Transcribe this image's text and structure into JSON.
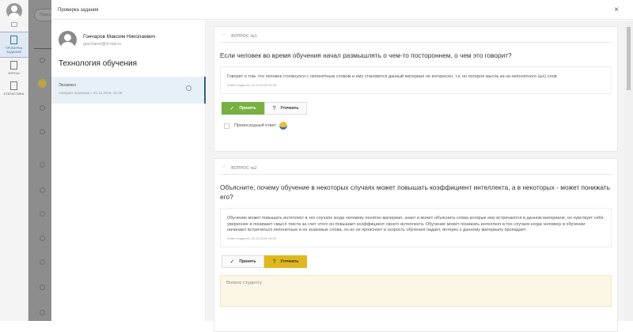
{
  "nav": {
    "items": [
      {
        "label": "Проверка заданий",
        "active": true
      },
      {
        "label": "Курсы"
      },
      {
        "label": "Статистика"
      }
    ]
  },
  "background": {
    "search_placeholder": "Поиск"
  },
  "modal": {
    "title": "Проверка задания",
    "close": "×"
  },
  "student": {
    "name": "Гончаров Максим Николаевич",
    "email": "goncharov@rk-nsk.ru"
  },
  "course": "Технология обучения",
  "task": {
    "name": "Экзамен",
    "status": "Ожидает проверки с 02.12.2018, 16:39"
  },
  "questions": [
    {
      "header": "ВОПРОС №1",
      "text": "Если человек во время обучения начал размышлять о чем-то постороннем, о чем это говорит?",
      "answer": "Говорит о том, что человек столкнулся с непонятным словом и ему становится данный материал не интересен, т.к. он потерял мысль из-за непонятного (ых) слов",
      "meta": "Ответ студента, 02.12.2018 16:39",
      "accept": "Принять",
      "clarify": "Уточнить",
      "excellent": "Превосходный ответ"
    },
    {
      "header": "ВОПРОС №2",
      "text": "Объясните, почему обучение в некоторых случаях может повышать коэффициент интеллекта, а в некоторых - может понижать его?",
      "answer": "Обучение может повышать интеллект в тех случаях когда человеку понятен материал, знает и может объяснить слова которые ему встречаются в данном материале, он чувствует себя увереннее и понимает смысл текста за счет этого он повышает коэффициент своего интеллекта. Обучение может понижать интеллект в тех случаях когда человеку в обучении начинают встречаться непонятные и не знакомые слова, он их не проясняет и скорость обучения падает, интерес к данному материалу пропадает.",
      "meta": "Ответ студента, 02.12.2018 16:39",
      "accept": "Принять",
      "clarify": "Уточнить",
      "question_placeholder": "Вопрос студенту"
    }
  ],
  "colors": {
    "accept": "#78b13f",
    "clarify": "#dfb820",
    "active_nav": "#3a6ea5"
  }
}
